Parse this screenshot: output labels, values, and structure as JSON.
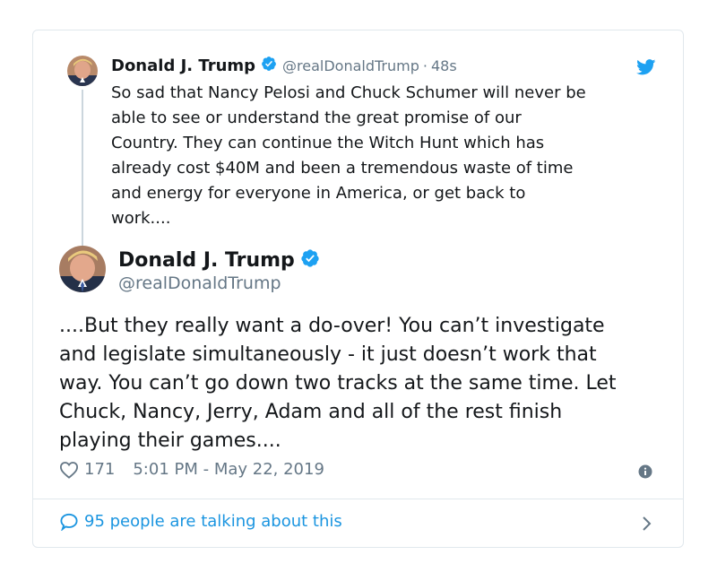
{
  "colors": {
    "accent": "#1b95e0",
    "verified": "#1da1f2",
    "muted": "#657786",
    "text": "#14171a",
    "border": "#e1e8ed"
  },
  "parent_tweet": {
    "name": "Donald J. Trump",
    "handle": "@realDonaldTrump",
    "separator": "·",
    "time": "48s",
    "text": "So sad that Nancy Pelosi and Chuck Schumer will never be\nable to see or understand the great promise of our\nCountry. They can continue the Witch Hunt which has\nalready cost $40M and been a tremendous waste of time\nand energy for everyone in America, or get back to\nwork....",
    "icons": [
      "avatar",
      "verified-badge-icon",
      "twitter-bird-icon"
    ]
  },
  "main_tweet": {
    "name": "Donald J. Trump",
    "handle": "@realDonaldTrump",
    "text": "....But they really want a do-over! You can’t investigate\nand legislate simultaneously - it just doesn’t work that\nway. You can’t go down two tracks at the same time. Let\nChuck, Nancy, Jerry, Adam and all of the rest finish\nplaying their games....",
    "likes": "171",
    "timestamp": "5:01 PM - May 22, 2019",
    "icons": [
      "avatar",
      "verified-badge-icon",
      "heart-icon",
      "info-icon"
    ]
  },
  "footer": {
    "talking_label": "95 people are talking about this",
    "icons": [
      "speech-bubble-icon",
      "chevron-right-icon"
    ]
  }
}
